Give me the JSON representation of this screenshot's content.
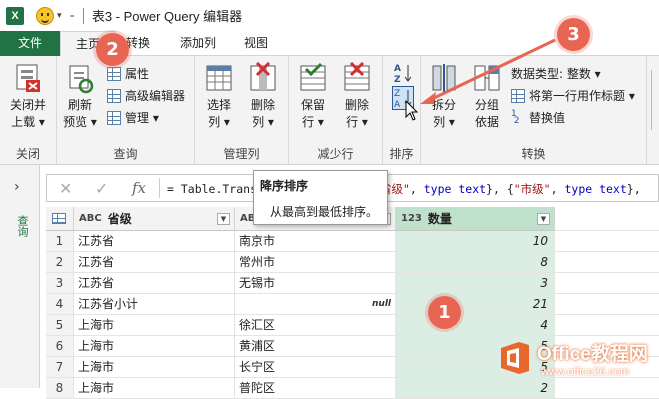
{
  "window": {
    "title": "表3 - Power Query 编辑器",
    "app_icon": "X"
  },
  "tabs": [
    {
      "label": "文件"
    },
    {
      "label": "主页"
    },
    {
      "label": "转换"
    },
    {
      "label": "添加列"
    },
    {
      "label": "视图"
    }
  ],
  "ribbon": {
    "close_load_line1": "关闭并",
    "close_load_line2": "上载",
    "close_group": "关闭",
    "refresh_line1": "刷新",
    "refresh_line2": "预览",
    "properties": "属性",
    "advanced_editor": "高级编辑器",
    "manage": "管理",
    "query_group": "查询",
    "choose_cols_line1": "选择",
    "choose_cols_line2": "列",
    "remove_cols_line1": "删除",
    "remove_cols_line2": "列",
    "manage_cols_group": "管理列",
    "keep_rows_line1": "保留",
    "keep_rows_line2": "行",
    "remove_rows_line1": "删除",
    "remove_rows_line2": "行",
    "reduce_rows_group": "减少行",
    "sort_group": "排序",
    "split_col_line1": "拆分",
    "split_col_line2": "列",
    "group_by_line1": "分组",
    "group_by_line2": "依据",
    "data_type": "数据类型: 整数",
    "use_first_row": "将第一行用作标题",
    "replace_values": "替换值",
    "transform_group": "转换"
  },
  "formula": {
    "prefix": "= Table.Trans",
    "part1": "\"省级\"",
    "part2": ", ",
    "kw1": "type text",
    "part3": "}, {",
    "part4": "\"市级\"",
    "part5": ", ",
    "kw2": "type text",
    "part6": "},"
  },
  "tooltip": {
    "title": "降序排序",
    "description": "从最高到最低排序。"
  },
  "query_pane": {
    "label": "查询"
  },
  "table": {
    "columns": [
      {
        "type": "ABC",
        "name": "省级"
      },
      {
        "type": "ABC",
        "name": "市级"
      },
      {
        "type": "123",
        "name": "数量"
      }
    ],
    "rows": [
      {
        "n": "1",
        "prov": "江苏省",
        "city": "南京市",
        "count": "10"
      },
      {
        "n": "2",
        "prov": "江苏省",
        "city": "常州市",
        "count": "8"
      },
      {
        "n": "3",
        "prov": "江苏省",
        "city": "无锡市",
        "count": "3"
      },
      {
        "n": "4",
        "prov": "江苏省小计",
        "city": "null",
        "count": "21"
      },
      {
        "n": "5",
        "prov": "上海市",
        "city": "徐汇区",
        "count": "4"
      },
      {
        "n": "6",
        "prov": "上海市",
        "city": "黄浦区",
        "count": "5"
      },
      {
        "n": "7",
        "prov": "上海市",
        "city": "长宁区",
        "count": "5"
      },
      {
        "n": "8",
        "prov": "上海市",
        "city": "普陀区",
        "count": "2"
      }
    ]
  },
  "callouts": {
    "one": "1",
    "two": "2",
    "three": "3"
  },
  "watermark": {
    "name": "Office教程网",
    "url": "www.office26.com"
  },
  "colors": {
    "accent": "#217346",
    "callout": "#e86553",
    "selected_column": "#dceee3"
  }
}
